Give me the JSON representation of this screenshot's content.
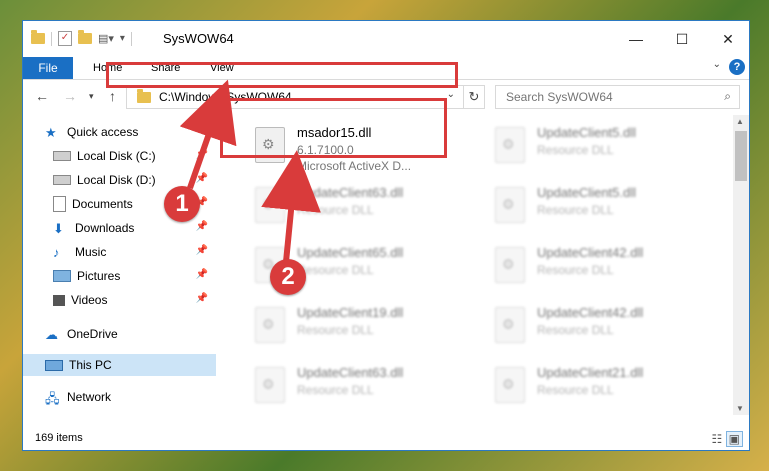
{
  "window": {
    "title": "SysWOW64",
    "controls": {
      "minimize": "—",
      "maximize": "☐",
      "close": "✕"
    }
  },
  "ribbon": {
    "tabs": [
      "File",
      "Home",
      "Share",
      "View"
    ],
    "help_label": "?"
  },
  "address": {
    "path": "C:\\Windows\\SysWOW64",
    "search_placeholder": "Search SysWOW64"
  },
  "nav": {
    "items": [
      {
        "label": "Quick access",
        "icon": "star-icon",
        "pinned": false
      },
      {
        "label": "Local Disk (C:)",
        "icon": "drive-icon",
        "pinned": true
      },
      {
        "label": "Local Disk (D:)",
        "icon": "drive-icon",
        "pinned": true
      },
      {
        "label": "Documents",
        "icon": "documents-icon",
        "pinned": true
      },
      {
        "label": "Downloads",
        "icon": "download-icon",
        "pinned": true
      },
      {
        "label": "Music",
        "icon": "music-icon",
        "pinned": true
      },
      {
        "label": "Pictures",
        "icon": "pictures-icon",
        "pinned": true
      },
      {
        "label": "Videos",
        "icon": "videos-icon",
        "pinned": true
      },
      {
        "label": "OneDrive",
        "icon": "cloud-icon",
        "pinned": false
      },
      {
        "label": "This PC",
        "icon": "computer-icon",
        "pinned": false
      },
      {
        "label": "Network",
        "icon": "network-icon",
        "pinned": false
      }
    ],
    "selected": "This PC"
  },
  "files": [
    {
      "name": "msador15.dll",
      "line1": "6.1.7100.0",
      "line2": "Microsoft ActiveX D...",
      "highlight": true
    },
    {
      "name": "UpdateClient5.dll",
      "line1": "Resource DLL"
    },
    {
      "name": "UpdateClient63.dll",
      "line1": "Resource DLL"
    },
    {
      "name": "UpdateClient5.dll",
      "line1": "Resource DLL"
    },
    {
      "name": "UpdateClient65.dll",
      "line1": "Resource DLL"
    },
    {
      "name": "UpdateClient42.dll",
      "line1": "Resource DLL"
    },
    {
      "name": "UpdateClient19.dll",
      "line1": "Resource DLL"
    },
    {
      "name": "UpdateClient42.dll",
      "line1": "Resource DLL"
    },
    {
      "name": "UpdateClient63.dll",
      "line1": "Resource DLL"
    },
    {
      "name": "UpdateClient21.dll",
      "line1": "Resource DLL"
    }
  ],
  "status": {
    "count": "169 items"
  },
  "annotations": {
    "step1": "1",
    "step2": "2"
  },
  "colors": {
    "accent": "#1a6fc4",
    "annotation": "#d93b3b",
    "selected": "#cce4f7"
  }
}
